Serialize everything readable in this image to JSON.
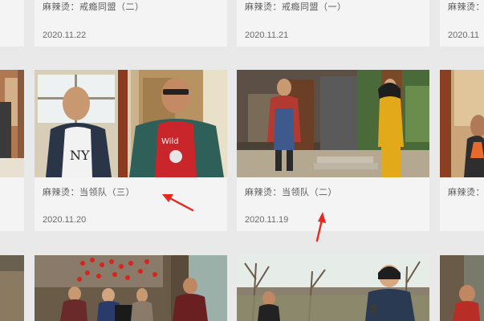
{
  "videos": [
    {
      "title": "麻辣烫：戒瘾同盟（二）",
      "date": "2020.11.22"
    },
    {
      "title": "麻辣烫：戒瘾同盟（一）",
      "date": "2020.11.21"
    },
    {
      "title": "麻辣烫：",
      "date": "2020.11"
    },
    {
      "title": "麻辣烫：当领队（三）",
      "date": "2020.11.20"
    },
    {
      "title": "麻辣烫：当领队（二）",
      "date": "2020.11.19"
    },
    {
      "title": "麻辣烫：",
      "date": ""
    }
  ],
  "colors": {
    "annotation_arrow": "#e8281e",
    "card_background": "#f4f4f4",
    "page_background": "#e9e9e9"
  }
}
